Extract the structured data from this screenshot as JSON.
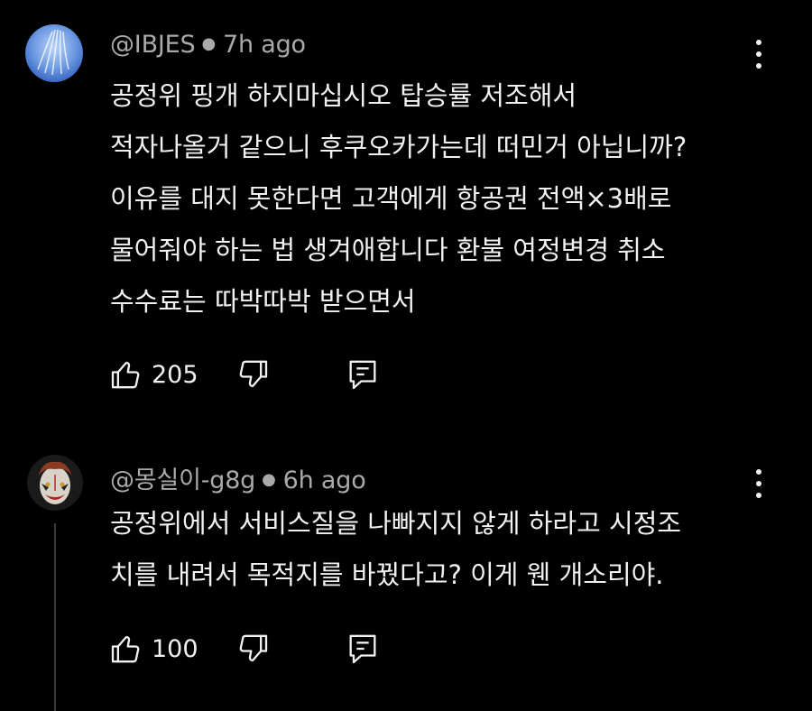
{
  "comments": [
    {
      "author": "@IBJES",
      "time": "7h ago",
      "lines": [
        "공정위 핑개 하지마십시오 탑승률 저조해서",
        "적자나올거 같으니 후쿠오카가는데 떠민거 아닙니까?",
        "이유를 대지 못한다면 고객에게 항공권 전액×3배로",
        "물어줘야 하는 법 생겨애합니다 환불 여정변경 취소",
        "수수료는 따박따박 받으면서"
      ],
      "likes": "205"
    },
    {
      "author": "@몽실이-g8g",
      "time": "6h ago",
      "lines": [
        "공정위에서 서비스질을 나빠지지 않게 하라고 시정조",
        "치를 내려서 목적지를 바꿨다고? 이게 웬 개소리야."
      ],
      "likes": "100"
    }
  ],
  "colors": {
    "background": "#000000",
    "text": "#f1f1f1",
    "meta": "#aaaaaa"
  },
  "icons": {
    "like": "thumbs-up-icon",
    "dislike": "thumbs-down-icon",
    "reply": "reply-comment-icon",
    "menu": "more-vertical-icon"
  }
}
